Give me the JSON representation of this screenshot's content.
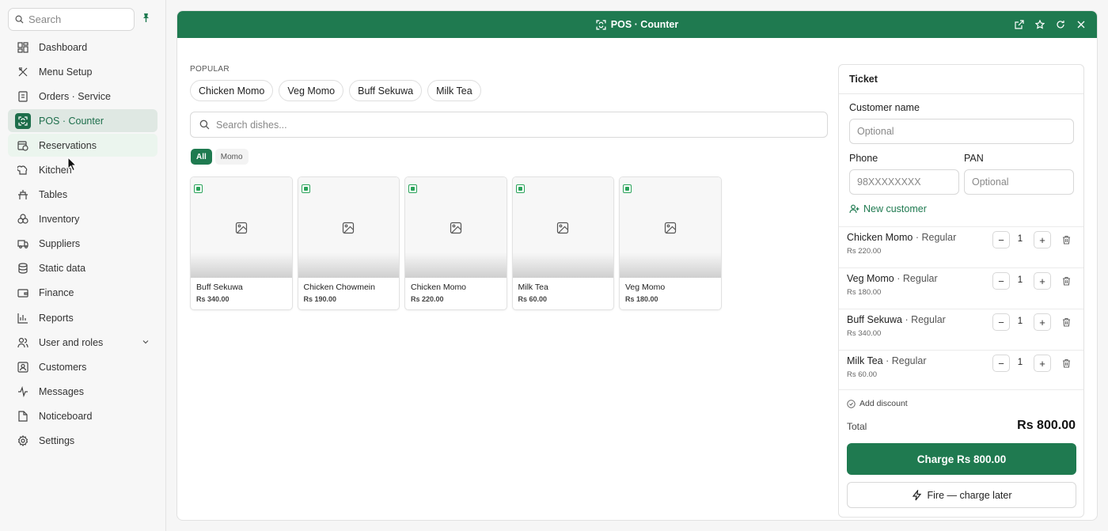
{
  "sidebar": {
    "search_placeholder": "Search",
    "items": [
      {
        "label": "Dashboard",
        "icon": "dashboard-icon"
      },
      {
        "label": "Menu Setup",
        "icon": "utensils-icon"
      },
      {
        "label": "Orders · Service",
        "icon": "receipt-icon"
      },
      {
        "label": "POS · Counter",
        "icon": "scan-icon",
        "active": true
      },
      {
        "label": "Reservations",
        "icon": "calendar-clock-icon"
      },
      {
        "label": "Kitchen",
        "icon": "chef-hat-icon"
      },
      {
        "label": "Tables",
        "icon": "table-icon"
      },
      {
        "label": "Inventory",
        "icon": "boxes-icon"
      },
      {
        "label": "Suppliers",
        "icon": "truck-icon"
      },
      {
        "label": "Static data",
        "icon": "database-icon"
      },
      {
        "label": "Finance",
        "icon": "wallet-icon"
      },
      {
        "label": "Reports",
        "icon": "bar-chart-icon"
      },
      {
        "label": "User and roles",
        "icon": "users-icon"
      },
      {
        "label": "Customers",
        "icon": "contact-icon"
      },
      {
        "label": "Messages",
        "icon": "activity-icon"
      },
      {
        "label": "Noticeboard",
        "icon": "file-icon"
      },
      {
        "label": "Settings",
        "icon": "gear-icon"
      }
    ]
  },
  "window": {
    "title": "POS · Counter"
  },
  "pos": {
    "popular_label": "POPULAR",
    "popular": [
      "Chicken Momo",
      "Veg Momo",
      "Buff Sekuwa",
      "Milk Tea"
    ],
    "search_placeholder": "Search dishes...",
    "filters": [
      "All",
      "Momo"
    ],
    "dishes": [
      {
        "name": "Buff Sekuwa",
        "price": "Rs 340.00"
      },
      {
        "name": "Chicken Chowmein",
        "price": "Rs 190.00"
      },
      {
        "name": "Chicken Momo",
        "price": "Rs 220.00"
      },
      {
        "name": "Milk Tea",
        "price": "Rs 60.00"
      },
      {
        "name": "Veg Momo",
        "price": "Rs 180.00"
      }
    ]
  },
  "ticket": {
    "title": "Ticket",
    "customer_label": "Customer name",
    "customer_placeholder": "Optional",
    "phone_label": "Phone",
    "phone_placeholder": "98XXXXXXXX",
    "pan_label": "PAN",
    "pan_placeholder": "Optional",
    "new_customer": "New customer",
    "lines": [
      {
        "name": "Chicken Momo",
        "variant": "· Regular",
        "price": "Rs 220.00",
        "qty": "1"
      },
      {
        "name": "Veg Momo",
        "variant": "· Regular",
        "price": "Rs 180.00",
        "qty": "1"
      },
      {
        "name": "Buff Sekuwa",
        "variant": "· Regular",
        "price": "Rs 340.00",
        "qty": "1"
      },
      {
        "name": "Milk Tea",
        "variant": "· Regular",
        "price": "Rs 60.00",
        "qty": "1"
      }
    ],
    "add_discount": "Add discount",
    "total_label": "Total",
    "total_value": "Rs 800.00",
    "charge_button": "Charge Rs 800.00",
    "fire_button": "Fire — charge later"
  },
  "colors": {
    "accent": "#1f7a50",
    "active_bg": "#dfe8e3",
    "veg": "#2aa35a"
  }
}
